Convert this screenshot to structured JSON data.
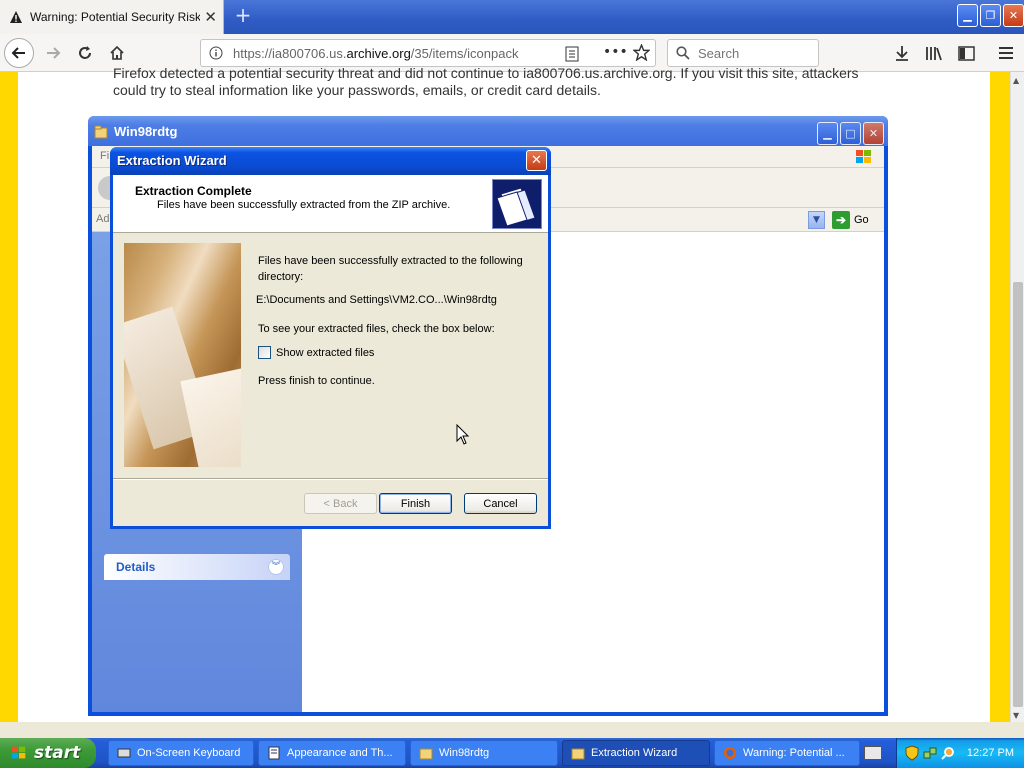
{
  "browser": {
    "tab_title": "Warning: Potential Security Risk A",
    "url_prefix": "https://ia800706.us.",
    "url_domain": "archive.org",
    "url_suffix": "/35/items/iconpack",
    "search_placeholder": "Search",
    "page_warning": "Firefox detected a potential security threat and did not continue to ia800706.us.archive.org. If you visit this site, attackers could try to steal information like your passwords, emails, or credit card details."
  },
  "explorer": {
    "title": "Win98rdtg",
    "menu_first": "Fi",
    "addr_label": "Ad",
    "go_label": "Go",
    "details_label": "Details"
  },
  "wizard": {
    "title": "Extraction Wizard",
    "header_title": "Extraction Complete",
    "header_subtitle": "Files have been successfully extracted from the ZIP archive.",
    "line1": "Files have been successfully extracted to the following",
    "line1b": "directory:",
    "path": "E:\\Documents and Settings\\VM2.CO...\\Win98rdtg",
    "line2": "To see your extracted files, check the box below:",
    "checkbox_label": "Show extracted files",
    "line3": "Press finish to continue.",
    "back_label": "< Back",
    "finish_label": "Finish",
    "cancel_label": "Cancel"
  },
  "taskbar": {
    "start_label": "start",
    "items": [
      {
        "label": "On-Screen Keyboard"
      },
      {
        "label": "Appearance and Th..."
      },
      {
        "label": "Win98rdtg"
      },
      {
        "label": "Extraction Wizard"
      },
      {
        "label": "Warning: Potential ..."
      }
    ],
    "clock": "12:27 PM"
  },
  "colors": {
    "xp_blue": "#0b4fd8",
    "page_border": "#ffd800",
    "start_green": "#3c9b37"
  }
}
